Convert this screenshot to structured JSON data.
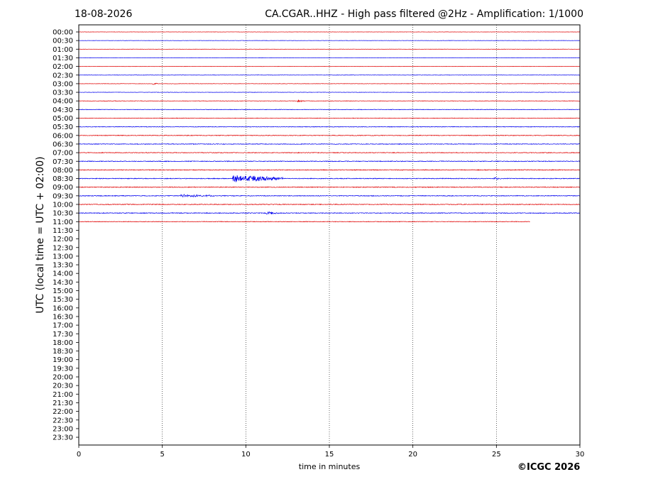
{
  "header": {
    "date": "18-08-2026",
    "title": "CA.CGAR..HHZ - High pass filtered @2Hz - Amplification: 1/1000"
  },
  "footer": {
    "copyright": "©ICGC 2026"
  },
  "chart_data": {
    "type": "line",
    "title": "CA.CGAR..HHZ - High pass filtered @2Hz - Amplification: 1/1000",
    "xlabel": "time in minutes",
    "ylabel": "UTC (local time = UTC + 02:00)",
    "xlim": [
      0,
      30
    ],
    "xticks": [
      0,
      5,
      10,
      15,
      20,
      25,
      30
    ],
    "grid": "vertical dotted at x ticks",
    "colors": {
      "red": "#e00000",
      "blue": "#0000ee"
    },
    "rows": [
      "00:00",
      "00:30",
      "01:00",
      "01:30",
      "02:00",
      "02:30",
      "03:00",
      "03:30",
      "04:00",
      "04:30",
      "05:00",
      "05:30",
      "06:00",
      "06:30",
      "07:00",
      "07:30",
      "08:00",
      "08:30",
      "09:00",
      "09:30",
      "10:00",
      "10:30",
      "11:00",
      "11:30",
      "12:00",
      "12:30",
      "13:00",
      "13:30",
      "14:00",
      "14:30",
      "15:00",
      "15:30",
      "16:00",
      "16:30",
      "17:00",
      "17:30",
      "18:00",
      "18:30",
      "19:00",
      "19:30",
      "20:00",
      "20:30",
      "21:00",
      "21:30",
      "22:00",
      "22:30",
      "23:00",
      "23:30"
    ],
    "series": [
      {
        "row": "00:00",
        "color": "red",
        "end": 30,
        "noise": 0.4,
        "events": []
      },
      {
        "row": "00:30",
        "color": "blue",
        "end": 30,
        "noise": 0.4,
        "events": []
      },
      {
        "row": "01:00",
        "color": "red",
        "end": 30,
        "noise": 0.4,
        "events": []
      },
      {
        "row": "01:30",
        "color": "blue",
        "end": 30,
        "noise": 0.4,
        "events": []
      },
      {
        "row": "02:00",
        "color": "red",
        "end": 30,
        "noise": 0.4,
        "events": []
      },
      {
        "row": "02:30",
        "color": "blue",
        "end": 30,
        "noise": 0.5,
        "events": []
      },
      {
        "row": "03:00",
        "color": "red",
        "end": 30,
        "noise": 0.5,
        "events": [
          {
            "t": 4.4,
            "dur": 0.3,
            "amp": 1.5
          }
        ]
      },
      {
        "row": "03:30",
        "color": "blue",
        "end": 30,
        "noise": 0.5,
        "events": []
      },
      {
        "row": "04:00",
        "color": "red",
        "end": 30,
        "noise": 0.6,
        "events": [
          {
            "t": 13.1,
            "dur": 0.4,
            "amp": 2
          }
        ]
      },
      {
        "row": "04:30",
        "color": "blue",
        "end": 30,
        "noise": 0.7,
        "events": []
      },
      {
        "row": "05:00",
        "color": "red",
        "end": 30,
        "noise": 0.7,
        "events": []
      },
      {
        "row": "05:30",
        "color": "blue",
        "end": 30,
        "noise": 0.8,
        "events": []
      },
      {
        "row": "06:00",
        "color": "red",
        "end": 30,
        "noise": 0.9,
        "events": []
      },
      {
        "row": "06:30",
        "color": "blue",
        "end": 30,
        "noise": 0.9,
        "events": []
      },
      {
        "row": "07:00",
        "color": "red",
        "end": 30,
        "noise": 0.9,
        "events": []
      },
      {
        "row": "07:30",
        "color": "blue",
        "end": 30,
        "noise": 1.0,
        "events": []
      },
      {
        "row": "08:00",
        "color": "red",
        "end": 30,
        "noise": 1.0,
        "events": []
      },
      {
        "row": "08:30",
        "color": "blue",
        "end": 30,
        "noise": 1.0,
        "events": [
          {
            "t": 9.2,
            "dur": 3.0,
            "amp": 5
          },
          {
            "t": 24.8,
            "dur": 0.5,
            "amp": 1.5
          }
        ]
      },
      {
        "row": "09:00",
        "color": "red",
        "end": 30,
        "noise": 1.0,
        "events": []
      },
      {
        "row": "09:30",
        "color": "blue",
        "end": 30,
        "noise": 1.0,
        "events": [
          {
            "t": 6.1,
            "dur": 2.0,
            "amp": 2
          }
        ]
      },
      {
        "row": "10:00",
        "color": "red",
        "end": 30,
        "noise": 1.0,
        "events": []
      },
      {
        "row": "10:30",
        "color": "blue",
        "end": 30,
        "noise": 1.0,
        "events": [
          {
            "t": 11.2,
            "dur": 0.8,
            "amp": 2
          }
        ]
      },
      {
        "row": "11:00",
        "color": "red",
        "end": 27,
        "noise": 0.8,
        "events": []
      }
    ]
  }
}
